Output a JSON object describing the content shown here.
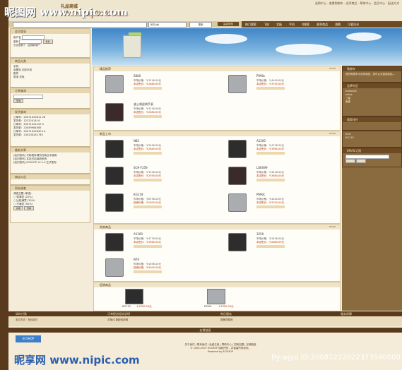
{
  "header": {
    "brand_mark": "昵图网",
    "shop_name": "礼品商城",
    "url": "www.nipic.com",
    "top_links": "选购中心 · 查看购物车 · 选项商品 · 帮助中心 · 会员中心 · 配送方式"
  },
  "search": {
    "category": "所有分类",
    "button": "搜索",
    "hot": "高级搜索"
  },
  "nav": [
    "热门搜索",
    "飞机",
    "北极",
    "手机",
    "Q搜索",
    "夏季商品",
    "减肥",
    "可爱风光",
    "服装"
  ],
  "left": {
    "login_title": "会员登录",
    "login_user": "用户名",
    "login_pass": "密码",
    "login_button": "登录",
    "login_links": "忘记密码? · 注册新用户",
    "cat_title": "商品分类",
    "cat_items": [
      "手机",
      "诺基亚 闪存手机",
      "配件",
      "电池 充电"
    ],
    "order_title": "订单查询",
    "order_button": "查询",
    "invoice_title": "发货查询",
    "invoices": [
      {
        "no": "订单号：20071025611 28",
        "code": "发货单：1231241414"
      },
      {
        "no": "订单号：20071021247 0",
        "code": "发货单：23459984585"
      },
      {
        "no": "订单号：20071022640 14",
        "code": "发货单：234234242745"
      }
    ],
    "news_title": "最新文章",
    "news": [
      "[站内快讯] 代码程序请勿在商业中使用",
      "[站内快讯] 本站已启用新系统",
      "[站内快讯] ECSHOP v2.1.0 正式发布"
    ],
    "ad_title": "商店公告",
    "vote_title": "网站调查",
    "vote_q": "调查主题 (单选)",
    "vote_opts": [
      "很满意 (25%)",
      "比较满意 (25%)",
      "不满意 (50%)"
    ],
    "vote_buttons": [
      "投票",
      "查看"
    ]
  },
  "center": {
    "best_title": "精品推荐",
    "best": [
      {
        "name": "S800",
        "mp": "市场价格：￥3216.00元",
        "sp": "本店售价：￥2680.00元"
      },
      {
        "name": "P990c",
        "mp": "市场价格：￥4440.00元",
        "sp": "本店售价：￥3700.00元"
      },
      {
        "name": "波士顿经典手表",
        "mp": "市场价格：￥3216.00元",
        "sp": "本店售价：￥2680.00元"
      }
    ],
    "new_title": "新品上市",
    "new": [
      {
        "name": "N82",
        "mp": "市场价格：￥3456.00元",
        "sp": "本店售价：￥2880.00元"
      },
      {
        "name": "A1200",
        "mp": "市场价格：￥4776.00元",
        "sp": "本店售价：￥3980.00元"
      },
      {
        "name": "SCH-F259",
        "mp": "市场价格：￥3108.00元",
        "sp": "本店售价：￥2590.00元"
      },
      {
        "name": "LOK099",
        "mp": "市场价格：￥4416.00元",
        "sp": "本店售价：￥3680.00元"
      },
      {
        "name": "KG119",
        "mp": "市场价格：￥6798.00元",
        "sp": "促销价格：￥2000.00元"
      },
      {
        "name": "P990c",
        "mp": "市场价格：￥4440.00元",
        "sp": "本店售价：￥3700.00元"
      }
    ],
    "hot_title": "热卖商品",
    "hot": [
      {
        "name": "A1200",
        "mp": "市场价格：￥4776.00元",
        "sp": "本店售价：￥3980.00元"
      },
      {
        "name": "3250",
        "mp": "市场价格：￥3456.00元",
        "sp": "本店售价：￥2880.00元"
      },
      {
        "name": "N76",
        "mp": "市场价格：￥4056.00元",
        "sp": "促销价格：￥3000.00元"
      }
    ],
    "promo_title": "促销商品",
    "promo": [
      {
        "name": "KG119",
        "price": "￥4000.00元"
      },
      {
        "name": "P990c",
        "price": "￥1900.00元"
      }
    ]
  },
  "right": {
    "cart_title": "购物车",
    "cart_text": "您的购物车中没有商品，您可以去挑选商品...",
    "shop_title": "品牌专区",
    "brand_items": [
      "motorola",
      "nokia",
      "三星",
      "索爱",
      "LG"
    ],
    "search_title": "搜索排行",
    "rank_items": [
      "N76",
      "KG119"
    ],
    "email_title": "EMAIL订阅",
    "email_buttons": [
      "订阅",
      "退订"
    ]
  },
  "footer": {
    "cols": [
      "如何付款",
      "订单配送相关说明",
      "售后服务",
      "服务保障"
    ],
    "links": [
      "支付方式 · 在线支付",
      "平邮/订单配送说明",
      "退换货原则",
      ""
    ],
    "bar2": "友情链接",
    "logo": "ECSHOP",
    "copyright1": "关于我们 | 联系我们 | 免费注册 | 帮助中心 | 招商加盟 | 友情链接",
    "copyright2": "© 2005-2007 ECSHOP 版权所有，并保留所有权利。",
    "copyright3": "Powered by ECSHOP"
  },
  "watermark": {
    "top": "昵图网 www.nipic.com",
    "bottom": "昵享网 www.nipic.com",
    "id": "By:wjyq ID:20081222022373540000"
  }
}
